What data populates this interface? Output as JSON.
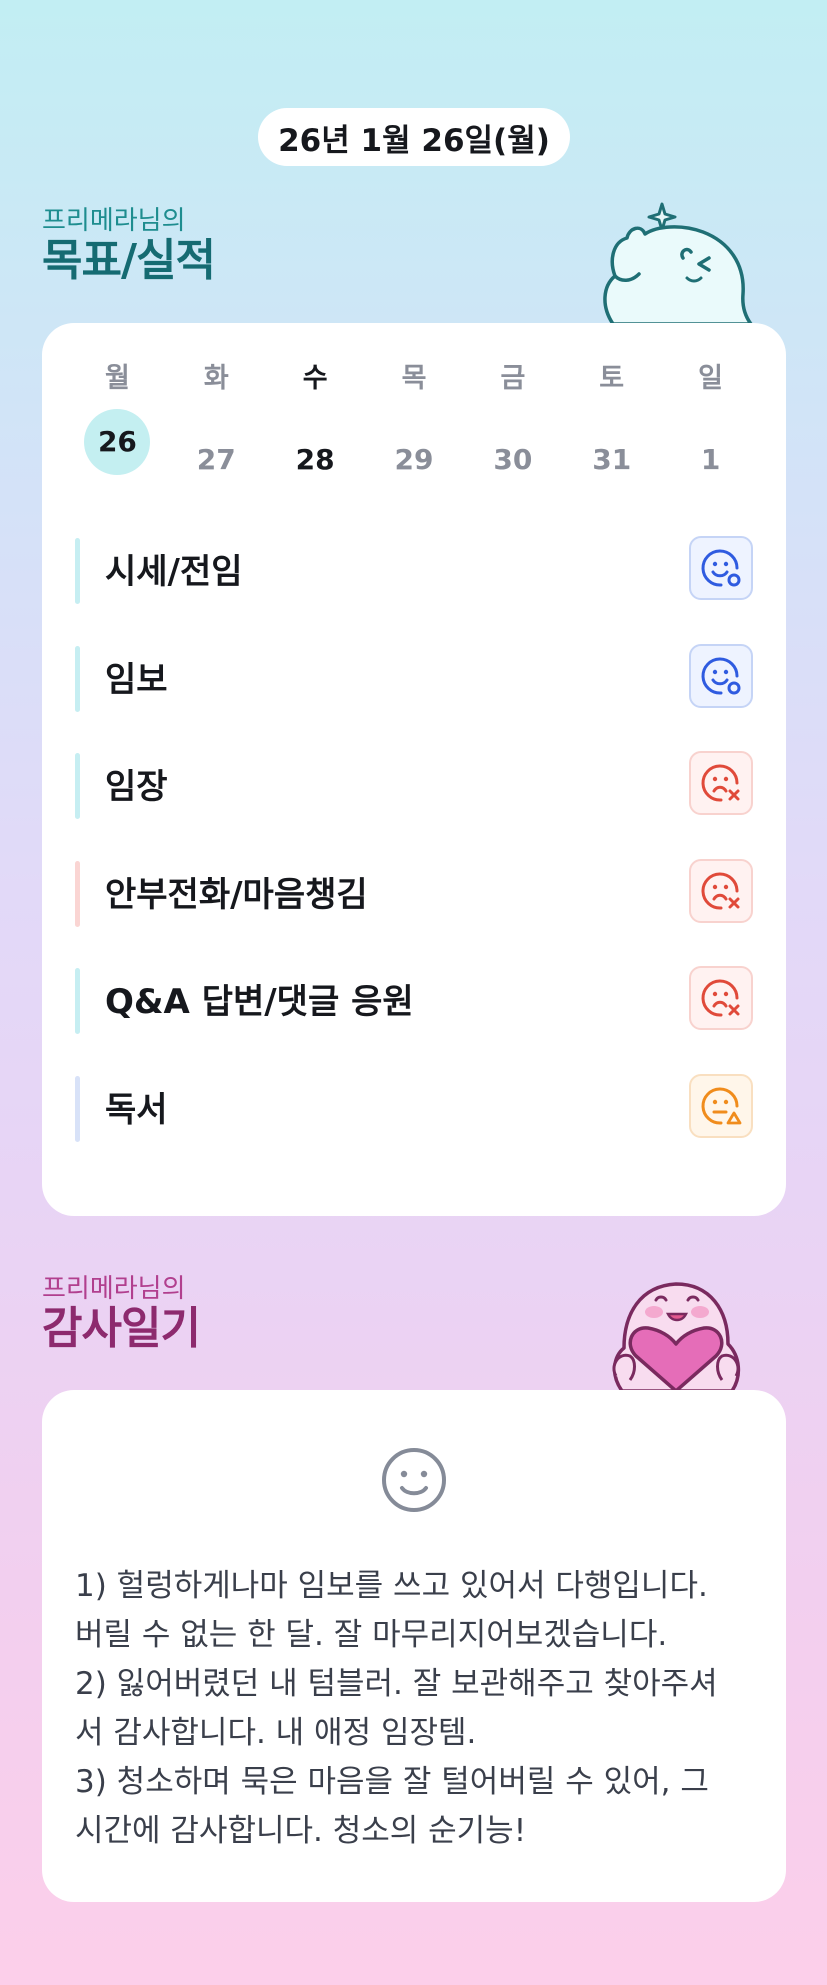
{
  "date": "26년 1월 26일(월)",
  "goals_section": {
    "subtitle": "프리메라님의",
    "title": "목표/실적"
  },
  "week": {
    "days": [
      {
        "name": "월",
        "num": "26",
        "selected": true,
        "today": false
      },
      {
        "name": "화",
        "num": "27",
        "selected": false,
        "today": false
      },
      {
        "name": "수",
        "num": "28",
        "selected": false,
        "today": true
      },
      {
        "name": "목",
        "num": "29",
        "selected": false,
        "today": false
      },
      {
        "name": "금",
        "num": "30",
        "selected": false,
        "today": false
      },
      {
        "name": "토",
        "num": "31",
        "selected": false,
        "today": false
      },
      {
        "name": "일",
        "num": "1",
        "selected": false,
        "today": false
      }
    ]
  },
  "goals": [
    {
      "label": "시세/전임",
      "status": "achieved",
      "icon": "smile-face-icon",
      "bar_color": "#c6eef2"
    },
    {
      "label": "임보",
      "status": "achieved",
      "icon": "smile-face-icon",
      "bar_color": "#c6eef2"
    },
    {
      "label": "임장",
      "status": "missed",
      "icon": "sad-face-x-icon",
      "bar_color": "#c6eef2"
    },
    {
      "label": "안부전화/마음챙김",
      "status": "missed",
      "icon": "sad-face-x-icon",
      "bar_color": "#fad5d3"
    },
    {
      "label": "Q&A 답변/댓글 응원",
      "status": "missed",
      "icon": "sad-face-x-icon",
      "bar_color": "#c6eef2"
    },
    {
      "label": "독서",
      "status": "partial",
      "icon": "neutral-face-warning-icon",
      "bar_color": "#d8e2f8"
    }
  ],
  "status_colors": {
    "achieved": {
      "fg": "#2f5be0",
      "bg": "#eef3ff",
      "border": "#c5d4f6"
    },
    "missed": {
      "fg": "#e04a3a",
      "bg": "#fff2f1",
      "border": "#f8d2ce"
    },
    "partial": {
      "fg": "#f08c1c",
      "bg": "#fff6ea",
      "border": "#f9dfc0"
    }
  },
  "gratitude_section": {
    "subtitle": "프리메라님의",
    "title": "감사일기"
  },
  "gratitude": {
    "mood_icon": "smile-face-icon",
    "text": "1) 헐렁하게나마 임보를 쓰고 있어서 다행입니다.\n버릴 수 없는 한 달. 잘 마무리지어보겠습니다.\n2) 잃어버렸던 내 텀블러. 잘 보관해주고 찾아주셔\n서 감사합니다. 내 애정 임장템.\n3) 청소하며 묵은 마음을 잘 털어버릴 수 있어, 그\n시간에 감사합니다. 청소의 순기능!"
  }
}
